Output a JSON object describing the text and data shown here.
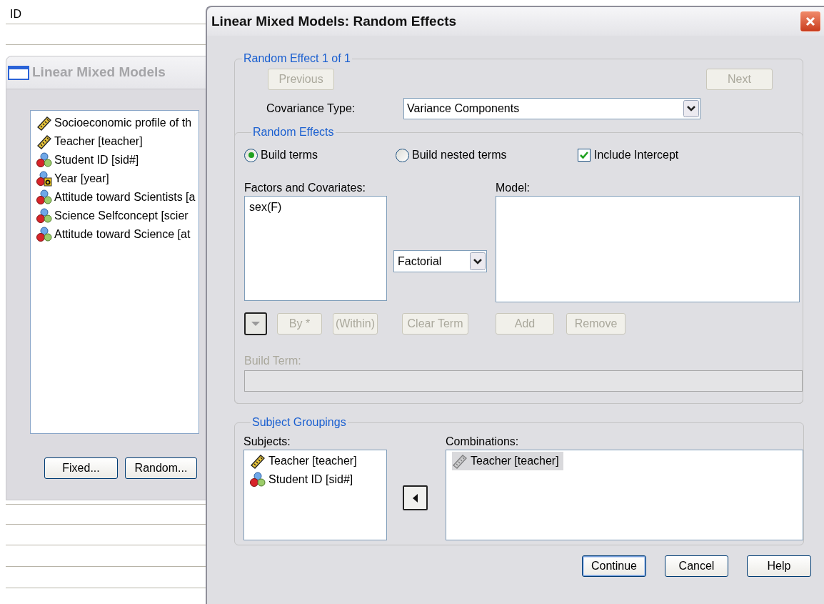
{
  "data_sheet": {
    "column_header": "ID"
  },
  "back_window": {
    "title": "Linear Mixed Models",
    "variables": [
      {
        "label": "Socioeconomic profile of th",
        "kind": "scale"
      },
      {
        "label": "Teacher [teacher]",
        "kind": "scale"
      },
      {
        "label": "Student ID [sid#]",
        "kind": "nominal"
      },
      {
        "label": "Year [year]",
        "kind": "string"
      },
      {
        "label": "Attitude toward Scientists [a",
        "kind": "nominal"
      },
      {
        "label": "Science Selfconcept [scier",
        "kind": "nominal"
      },
      {
        "label": "Attitude toward Science [at",
        "kind": "nominal"
      }
    ],
    "buttons": [
      "Fixed...",
      "Random..."
    ]
  },
  "dialog": {
    "title": "Linear Mixed Models: Random Effects",
    "random_effect": {
      "legend": "Random Effect 1 of 1",
      "previous": {
        "label": "Previous",
        "disabled": true
      },
      "next": {
        "label": "Next",
        "disabled": true
      },
      "covariance_label": "Covariance Type:",
      "covariance_value": "Variance Components"
    },
    "random_effects": {
      "legend": "Random Effects",
      "build_options": [
        {
          "label": "Build terms",
          "selected": true
        },
        {
          "label": "Build nested terms",
          "selected": false
        }
      ],
      "include_intercept": {
        "label": "Include Intercept",
        "checked": true
      },
      "factors_label": "Factors and Covariates:",
      "factors": [
        "sex(F)"
      ],
      "term_type": "Factorial",
      "model_label": "Model:",
      "term_buttons": [
        {
          "label": "By *",
          "disabled": true
        },
        {
          "label": "(Within)",
          "disabled": true
        },
        {
          "label": "Clear Term",
          "disabled": true
        }
      ],
      "model_buttons": [
        {
          "label": "Add",
          "disabled": true
        },
        {
          "label": "Remove",
          "disabled": true
        }
      ],
      "build_term_label": "Build Term:",
      "build_term_disabled": true
    },
    "subject_groupings": {
      "legend": "Subject Groupings",
      "subjects_label": "Subjects:",
      "subjects": [
        {
          "label": "Teacher [teacher]",
          "kind": "scale"
        },
        {
          "label": "Student ID [sid#]",
          "kind": "nominal"
        }
      ],
      "combinations_label": "Combinations:",
      "combinations": [
        {
          "label": "Teacher [teacher]",
          "kind": "scale",
          "selected": true
        }
      ]
    },
    "buttons": [
      {
        "label": "Continue",
        "default": true
      },
      {
        "label": "Cancel",
        "default": false
      },
      {
        "label": "Help",
        "default": false
      }
    ]
  }
}
